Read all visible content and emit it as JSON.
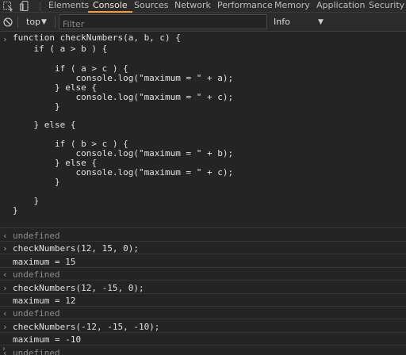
{
  "tabs": [
    {
      "label": "Elements"
    },
    {
      "label": "Console"
    },
    {
      "label": "Sources"
    },
    {
      "label": "Network"
    },
    {
      "label": "Performance"
    },
    {
      "label": "Memory"
    },
    {
      "label": "Application"
    },
    {
      "label": "Security"
    }
  ],
  "active_tab": "Console",
  "accent_color": "#f3a23b",
  "toolbar": {
    "context": "top",
    "filter_placeholder": "Filter",
    "level": "Info"
  },
  "console": {
    "function_code": [
      "function checkNumbers(a, b, c) {",
      "    if ( a > b ) {",
      "",
      "        if ( a > c ) {",
      "            console.log(\"maximum = \" + a);",
      "        } else {",
      "            console.log(\"maximum = \" + c);",
      "        }",
      "",
      "    } else {",
      "",
      "        if ( b > c ) {",
      "            console.log(\"maximum = \" + b);",
      "        } else {",
      "            console.log(\"maximum = \" + c);",
      "        }",
      "",
      "    }",
      "}"
    ],
    "entries": [
      {
        "type": "result",
        "text": "undefined"
      },
      {
        "type": "input",
        "text": "checkNumbers(12, 15, 0);"
      },
      {
        "type": "log",
        "text": "maximum = 15"
      },
      {
        "type": "result",
        "text": "undefined"
      },
      {
        "type": "input",
        "text": "checkNumbers(12, -15, 0);"
      },
      {
        "type": "log",
        "text": "maximum = 12"
      },
      {
        "type": "result",
        "text": "undefined"
      },
      {
        "type": "input",
        "text": "checkNumbers(-12, -15, -10);"
      },
      {
        "type": "log",
        "text": "maximum = -10"
      },
      {
        "type": "result",
        "text": "undefined"
      }
    ]
  }
}
